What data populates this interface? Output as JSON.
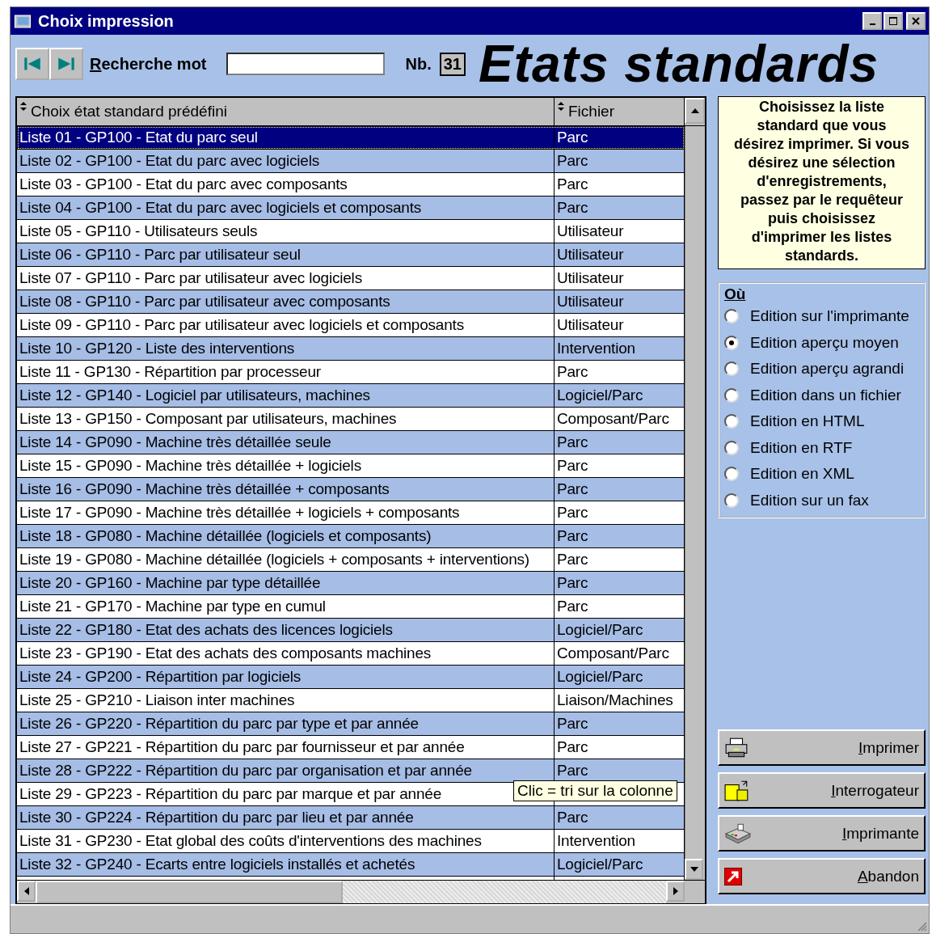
{
  "window": {
    "title": "Choix impression"
  },
  "toolbar": {
    "nav_buttons": [
      {
        "kind": "first"
      },
      {
        "kind": "last"
      }
    ],
    "search_label": "Recherche mot",
    "count_label": "Nb.",
    "count": "31",
    "heading": "Etats standards"
  },
  "table": {
    "columns": [
      "Choix état standard prédéfini",
      "Fichier"
    ],
    "rows": [
      {
        "label": "Liste 01 - GP100 - Etat du parc seul",
        "file": "Parc",
        "selected": true
      },
      {
        "label": "Liste 02 - GP100 - Etat du parc avec logiciels",
        "file": "Parc",
        "selected": false
      },
      {
        "label": "Liste 03 - GP100 - Etat du parc avec composants",
        "file": "Parc",
        "selected": false
      },
      {
        "label": "Liste 04 - GP100 - Etat du parc avec logiciels et composants",
        "file": "Parc",
        "selected": false
      },
      {
        "label": "Liste 05 - GP110 - Utilisateurs seuls",
        "file": "Utilisateur",
        "selected": false
      },
      {
        "label": "Liste 06 - GP110 - Parc par utilisateur seul",
        "file": "Utilisateur",
        "selected": false
      },
      {
        "label": "Liste 07 - GP110 - Parc par utilisateur avec logiciels",
        "file": "Utilisateur",
        "selected": false
      },
      {
        "label": "Liste 08 - GP110 - Parc par utilisateur avec composants",
        "file": "Utilisateur",
        "selected": false
      },
      {
        "label": "Liste 09 - GP110 - Parc par utilisateur avec logiciels et composants",
        "file": "Utilisateur",
        "selected": false
      },
      {
        "label": "Liste 10 - GP120 - Liste des interventions",
        "file": "Intervention",
        "selected": false
      },
      {
        "label": "Liste 11 - GP130 - Répartition par processeur",
        "file": "Parc",
        "selected": false
      },
      {
        "label": "Liste 12 - GP140 - Logiciel par utilisateurs, machines",
        "file": "Logiciel/Parc",
        "selected": false
      },
      {
        "label": "Liste 13 - GP150 - Composant par utilisateurs, machines",
        "file": "Composant/Parc",
        "selected": false
      },
      {
        "label": "Liste 14 - GP090 - Machine très détaillée seule",
        "file": "Parc",
        "selected": false
      },
      {
        "label": "Liste 15 - GP090 - Machine très détaillée + logiciels",
        "file": "Parc",
        "selected": false
      },
      {
        "label": "Liste 16 - GP090 - Machine très détaillée + composants",
        "file": "Parc",
        "selected": false
      },
      {
        "label": "Liste 17 - GP090 - Machine très détaillée + logiciels + composants",
        "file": "Parc",
        "selected": false
      },
      {
        "label": "Liste 18 - GP080 - Machine détaillée (logiciels et composants)",
        "file": "Parc",
        "selected": false
      },
      {
        "label": "Liste 19 - GP080 - Machine détaillée (logiciels + composants + interventions)",
        "file": "Parc",
        "selected": false
      },
      {
        "label": "Liste 20 - GP160 - Machine par type détaillée",
        "file": "Parc",
        "selected": false
      },
      {
        "label": "Liste 21 - GP170 - Machine par type en cumul",
        "file": "Parc",
        "selected": false
      },
      {
        "label": "Liste 22 - GP180 - Etat des achats des licences logiciels",
        "file": "Logiciel/Parc",
        "selected": false
      },
      {
        "label": "Liste 23 - GP190 - Etat des achats des composants machines",
        "file": "Composant/Parc",
        "selected": false
      },
      {
        "label": "Liste 24 - GP200 - Répartition par logiciels",
        "file": "Logiciel/Parc",
        "selected": false
      },
      {
        "label": "Liste 25 - GP210 - Liaison inter machines",
        "file": "Liaison/Machines",
        "selected": false
      },
      {
        "label": "Liste 26 - GP220 - Répartition du parc par type et par année",
        "file": "Parc",
        "selected": false
      },
      {
        "label": "Liste 27 - GP221 - Répartition du parc par fournisseur et par année",
        "file": "Parc",
        "selected": false
      },
      {
        "label": "Liste 28 - GP222 - Répartition du parc par organisation et par année",
        "file": "Parc",
        "selected": false
      },
      {
        "label": "Liste 29 - GP223 - Répartition du parc par marque et par année",
        "selected": false
      },
      {
        "label": "Liste 30 - GP224 - Répartition du parc par lieu et par année",
        "file": "Parc",
        "selected": false
      },
      {
        "label": "Liste 31 - GP230 - Etat global des coûts d'interventions des machines",
        "file": "Intervention",
        "selected": false
      },
      {
        "label": "Liste 32 - GP240 - Ecarts entre logiciels installés et achetés",
        "file": "Logiciel/Parc",
        "selected": false
      }
    ],
    "tooltip": "Clic = tri sur la colonne"
  },
  "info": "Choisissez la liste standard que vous désirez imprimer. Si vous désirez une sélection d'enregistrements, passez par le requêteur puis choisissez d'imprimer les listes standards.",
  "output": {
    "title": "Où",
    "options": [
      {
        "label": "Edition sur l'imprimante",
        "selected": false
      },
      {
        "label": "Edition aperçu moyen",
        "selected": true
      },
      {
        "label": "Edition aperçu agrandi",
        "selected": false
      },
      {
        "label": "Edition dans un fichier",
        "selected": false
      },
      {
        "label": "Edition en HTML",
        "selected": false
      },
      {
        "label": "Edition en RTF",
        "selected": false
      },
      {
        "label": "Edition en XML",
        "selected": false
      },
      {
        "label": "Edition sur un fax",
        "selected": false
      }
    ]
  },
  "buttons": [
    {
      "label": "Imprimer",
      "kind": "print"
    },
    {
      "label": "Interrogateur",
      "kind": "query"
    },
    {
      "label": "Imprimante",
      "kind": "printer"
    },
    {
      "label": "Abandon",
      "kind": "exit"
    }
  ]
}
